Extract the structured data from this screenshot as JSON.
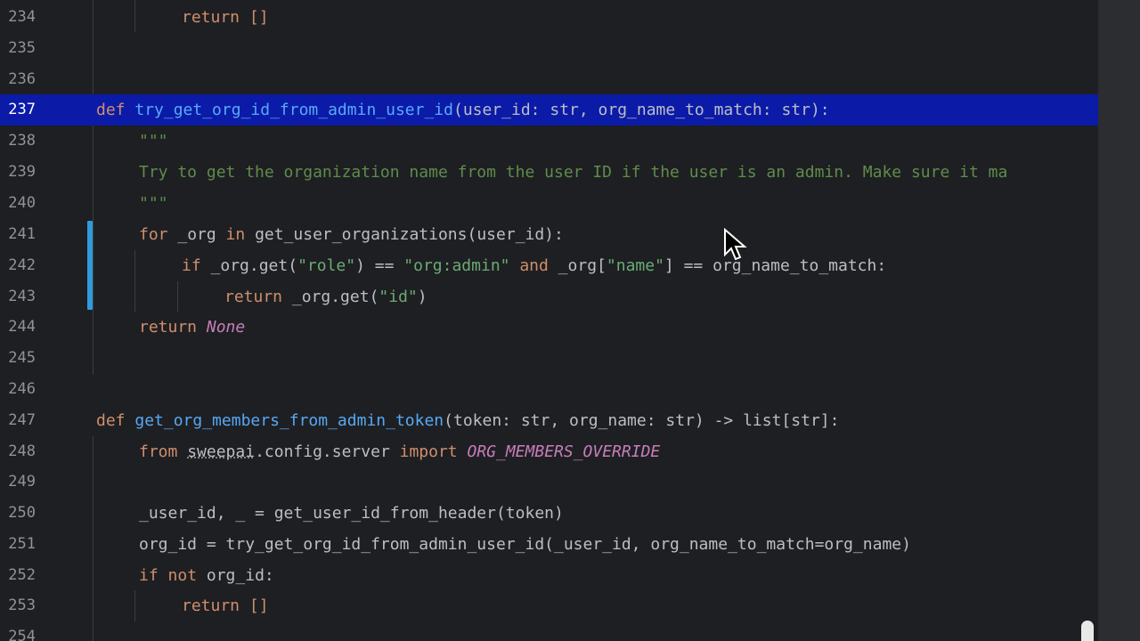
{
  "editor": {
    "current_line": "237",
    "lines": [
      {
        "num": "234",
        "text": "return []"
      },
      {
        "num": "235",
        "text": ""
      },
      {
        "num": "236",
        "text": ""
      },
      {
        "num": "237",
        "def_kw": "def",
        "func": "try_get_org_id_from_admin_user_id",
        "rest": "(user_id: str, org_name_to_match: str):"
      },
      {
        "num": "238",
        "text": "\"\"\""
      },
      {
        "num": "239",
        "text": "Try to get the organization name from the user ID if the user is an admin. Make sure it ma"
      },
      {
        "num": "240",
        "text": "\"\"\""
      },
      {
        "num": "241",
        "kw1": "for",
        "p1": " _org ",
        "kw2": "in",
        "p2": " get_user_organizations(user_id):"
      },
      {
        "num": "242",
        "kw1": "if",
        "p1": " _org.get(",
        "s1": "\"role\"",
        "p2": ") == ",
        "s2": "\"org:admin\"",
        "kw2": " and",
        "p3": " _org[",
        "s3": "\"name\"",
        "p4": "] == org_name_to_match:"
      },
      {
        "num": "243",
        "kw1": "return",
        "p1": " _org.get(",
        "s1": "\"id\"",
        "p2": ")"
      },
      {
        "num": "244",
        "kw1": "return",
        "it": "None"
      },
      {
        "num": "245",
        "text": ""
      },
      {
        "num": "246",
        "text": ""
      },
      {
        "num": "247",
        "def_kw": "def",
        "func": "get_org_members_from_admin_token",
        "rest": "(token: str, org_name: str) -> list[str]:"
      },
      {
        "num": "248",
        "kw1": "from",
        "mod": "sweepai",
        "p1": ".config.server ",
        "kw2": "import",
        "it": "ORG_MEMBERS_OVERRIDE"
      },
      {
        "num": "249",
        "text": ""
      },
      {
        "num": "250",
        "text": "_user_id, _ = get_user_id_from_header(token)"
      },
      {
        "num": "251",
        "text": "org_id = try_get_org_id_from_admin_user_id(_user_id, org_name_to_match=org_name)"
      },
      {
        "num": "252",
        "kw1": "if",
        "kw2": " not",
        "p1": " org_id:"
      },
      {
        "num": "253",
        "text": "return []"
      },
      {
        "num": "254",
        "text": ""
      }
    ]
  }
}
